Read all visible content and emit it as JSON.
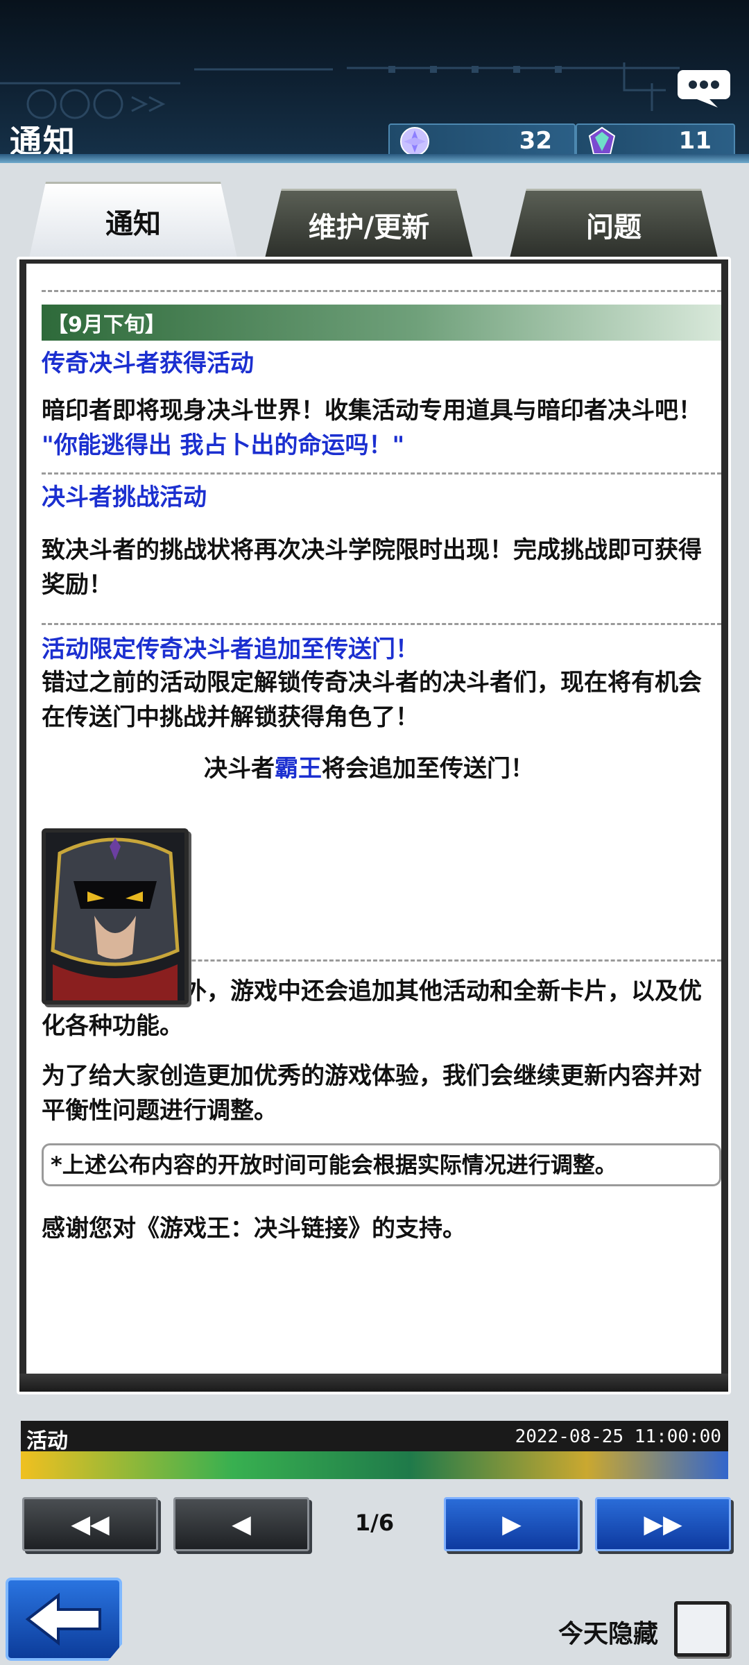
{
  "header": {
    "title": "通知",
    "gems": "32",
    "orbs": "11"
  },
  "tabs": [
    {
      "label": "通知",
      "active": true
    },
    {
      "label": "维护/更新",
      "active": false
    },
    {
      "label": "问题",
      "active": false
    }
  ],
  "notice": {
    "section": "【9月下旬】",
    "blocks": [
      {
        "title": "传奇决斗者获得活动",
        "body": "暗印者即将现身决斗世界！收集活动专用道具与暗印者决斗吧！",
        "quote": "\"你能逃得出 我占卜出的命运吗！\""
      },
      {
        "title": "决斗者挑战活动",
        "body": "致决斗者的挑战状将再次决斗学院限时出现！完成挑战即可获得奖励！"
      },
      {
        "title": "活动限定传奇决斗者追加至传送门！",
        "body": "错过之前的活动限定解锁传奇决斗者的决斗者们，现在将有机会在传送门中挑战并解锁获得角色了！"
      }
    ],
    "duelist_line": {
      "prefix": "决斗者",
      "name": "霸王",
      "suffix": "将会追加至传送门！"
    },
    "para1": "除了上述内容外，游戏中还会追加其他活动和全新卡片，以及优化各种功能。",
    "para2": "为了给大家创造更加优秀的游戏体验，我们会继续更新内容并对平衡性问题进行调整。",
    "note": "*上述公布内容的开放时间可能会根据实际情况进行调整。",
    "thanks": "感谢您对《游戏王：决斗链接》的支持。"
  },
  "event": {
    "label": "活动",
    "date": "2022-08-25 11:00:00"
  },
  "pager": {
    "indicator": "1/6",
    "first": "◀◀",
    "prev": "◀",
    "next": "▶",
    "last": "▶▶"
  },
  "footer": {
    "hide_today": "今天隐藏"
  },
  "colors": {
    "accent_blue": "#1b2fd0",
    "section_green": "#2e6a3a",
    "nav_blue": "#0e3aa0"
  }
}
